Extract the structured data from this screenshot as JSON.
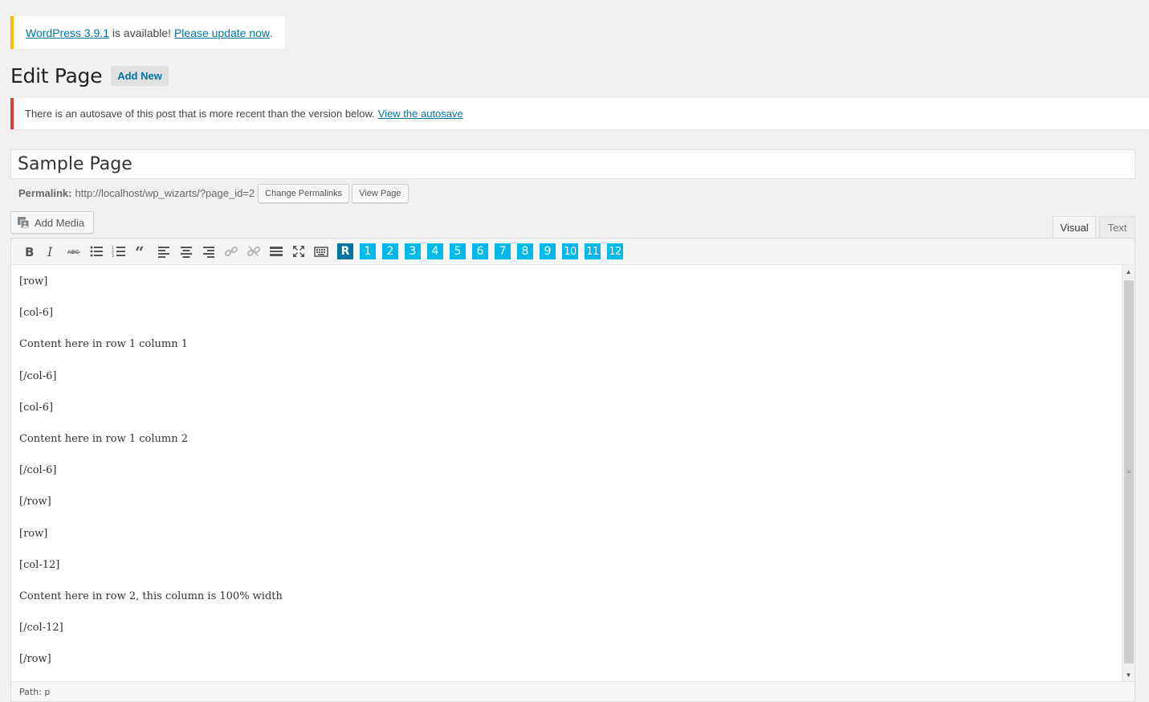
{
  "update_nag": {
    "link1": "WordPress 3.9.1",
    "middle": " is available! ",
    "link2": "Please update now",
    "end": "."
  },
  "heading": {
    "title": "Edit Page",
    "add_new": "Add New"
  },
  "autosave": {
    "message": "There is an autosave of this post that is more recent than the version below.",
    "link": "View the autosave"
  },
  "post": {
    "title": "Sample Page"
  },
  "permalink": {
    "label": "Permalink:",
    "url": "http://localhost/wp_wizarts/?page_id=2",
    "change_button": "Change Permalinks",
    "view_button": "View Page"
  },
  "media": {
    "add_media": "Add Media"
  },
  "editor_tabs": {
    "visual": "Visual",
    "text": "Text"
  },
  "toolbar": {
    "row_button": "R",
    "col_buttons": [
      "1",
      "2",
      "3",
      "4",
      "5",
      "6",
      "7",
      "8",
      "9",
      "10",
      "11",
      "12"
    ],
    "colors": {
      "row": "#0074a2",
      "col": "#00b9eb"
    }
  },
  "content": {
    "lines": [
      "[row]",
      "[col-6]",
      "Content here in row 1 column 1",
      "[/col-6]",
      "[col-6]",
      "Content here in row 1 column 2",
      "[/col-6]",
      "[/row]",
      "[row]",
      "[col-12]",
      "Content here in row 2, this column is 100% width",
      "[/col-12]",
      "[/row]"
    ]
  },
  "statusbar": {
    "path": "Path: p"
  },
  "colors": {
    "update_border": "#ffba00",
    "error_border": "#dd3d36",
    "link": "#0074a2"
  }
}
